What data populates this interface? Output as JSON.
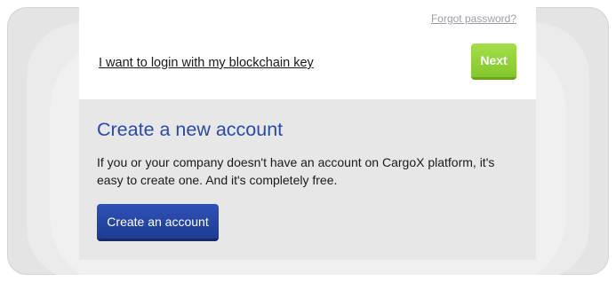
{
  "login": {
    "forgot_password_link": "Forgot password?",
    "blockchain_key_link": "I want to login with my blockchain key",
    "next_button": "Next"
  },
  "create_account": {
    "title": "Create a new account",
    "description": "If you or your company doesn't have an account on CargoX platform, it's easy to create one. And it's completely free.",
    "button": "Create an account"
  },
  "colors": {
    "next_button": "#8fd03a",
    "create_button": "#2a4aa8",
    "title": "#2a4aa8",
    "section_background": "#e7e7e7"
  }
}
